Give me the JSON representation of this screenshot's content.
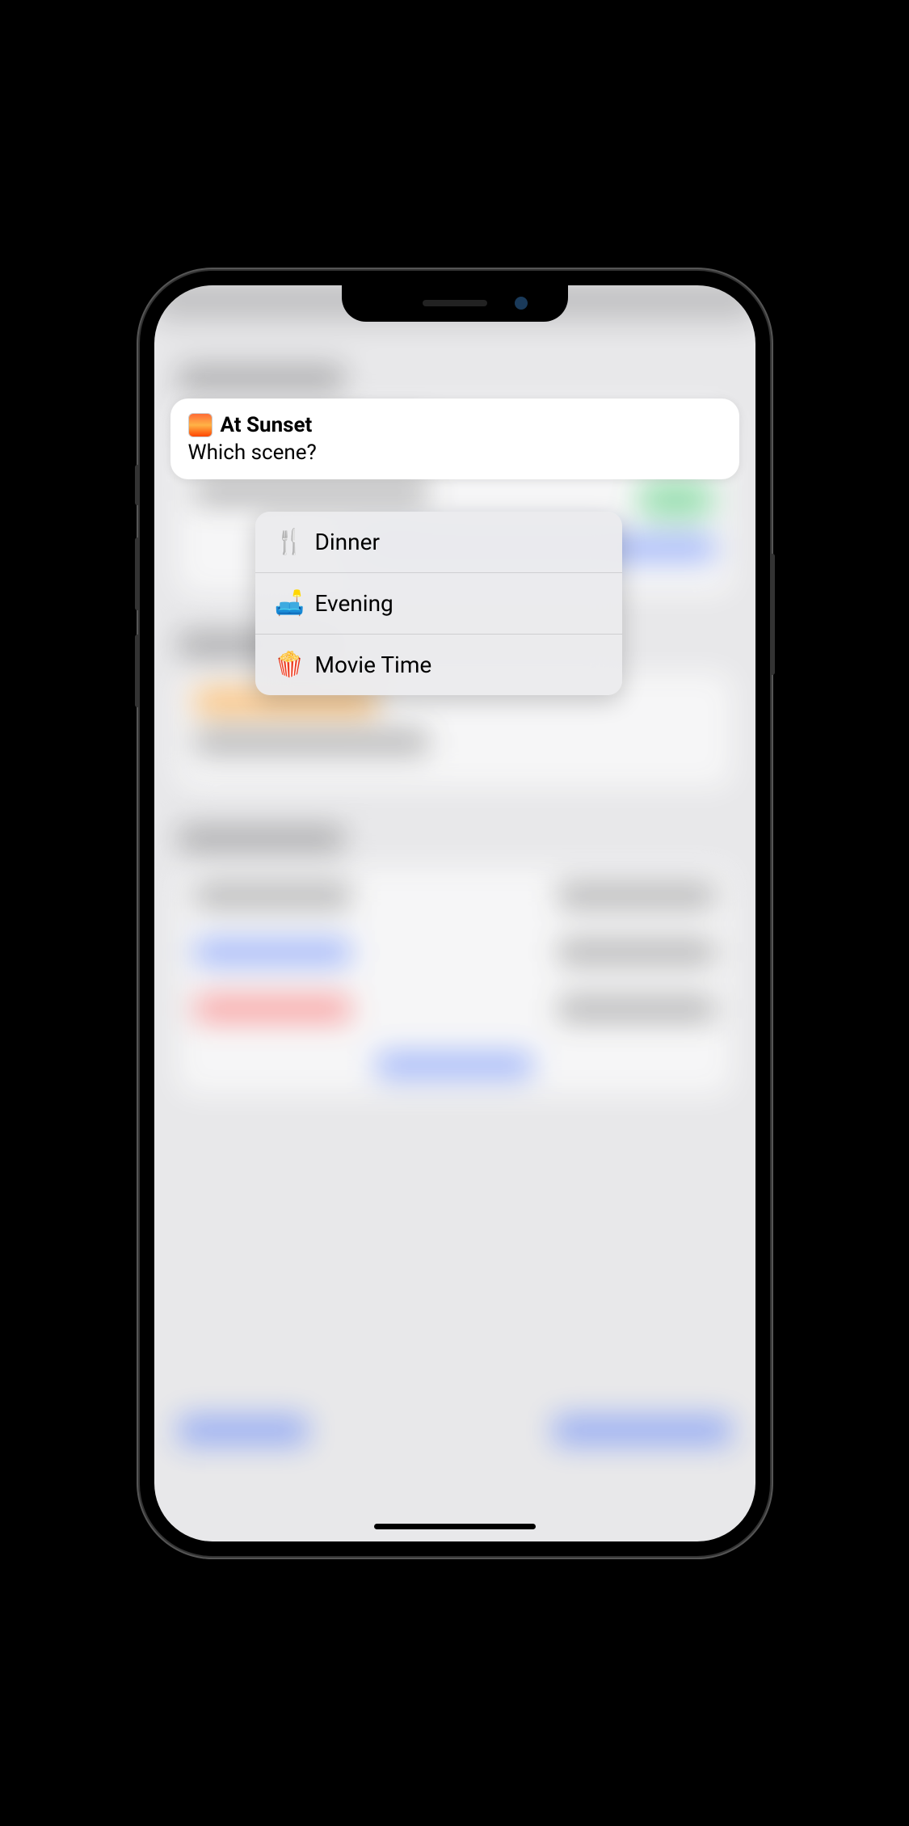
{
  "prompt": {
    "icon_name": "sunset-icon",
    "title": "At Sunset",
    "question": "Which scene?"
  },
  "options": [
    {
      "emoji": "🍴",
      "label": "Dinner",
      "name": "option-dinner"
    },
    {
      "emoji": "🛋️",
      "label": "Evening",
      "name": "option-evening"
    },
    {
      "emoji": "🍿",
      "label": "Movie Time",
      "name": "option-movie-time"
    }
  ]
}
